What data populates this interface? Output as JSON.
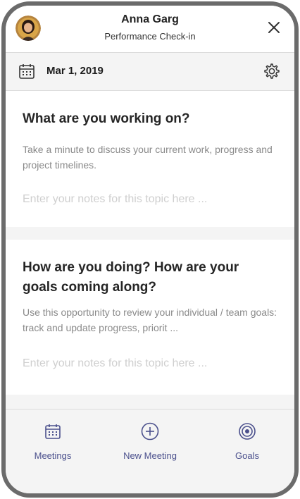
{
  "header": {
    "name": "Anna Garg",
    "subtitle": "Performance Check-in",
    "avatar_icon": "avatar-photo",
    "close_icon": "close-icon"
  },
  "datebar": {
    "date": "Mar 1, 2019",
    "calendar_icon": "calendar-icon",
    "settings_icon": "gear-icon"
  },
  "topics": [
    {
      "title": "What are you working on?",
      "description": "Take a minute to discuss your current work, progress and project timelines.",
      "placeholder": "Enter your notes for this topic here ..."
    },
    {
      "title": "How are you doing? How are your goals coming along?",
      "description": "Use this opportunity to review your individual / team goals: track and update progress, priorit ...",
      "placeholder": "Enter your notes for this topic here ..."
    }
  ],
  "bottom_nav": {
    "items": [
      {
        "label": "Meetings",
        "icon": "calendar-icon"
      },
      {
        "label": "New Meeting",
        "icon": "plus-circle-icon"
      },
      {
        "label": "Goals",
        "icon": "target-icon"
      }
    ]
  },
  "colors": {
    "accent": "#4a4f8c",
    "frame": "#6b6b6b",
    "background": "#f4f4f4"
  }
}
